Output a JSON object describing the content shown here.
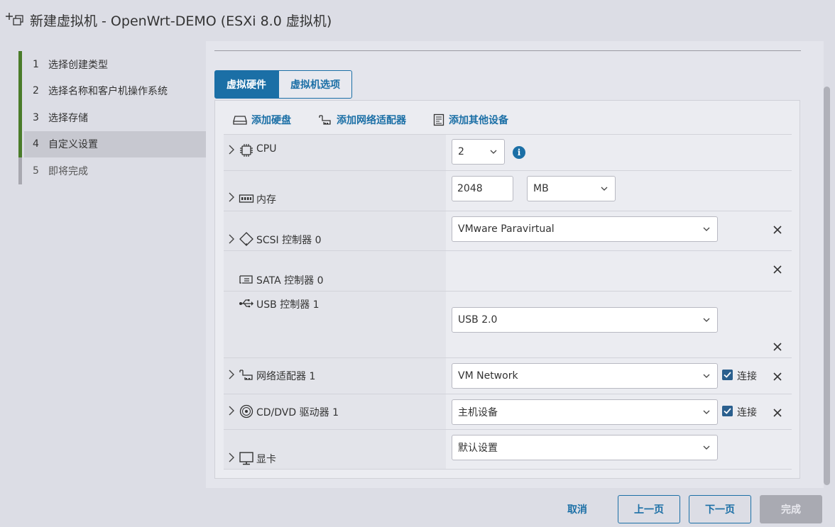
{
  "window": {
    "title": "新建虚拟机 - OpenWrt-DEMO (ESXi 8.0 虚拟机)"
  },
  "wizard": {
    "steps": [
      {
        "num": "1",
        "label": "选择创建类型",
        "state": "done"
      },
      {
        "num": "2",
        "label": "选择名称和客户机操作系统",
        "state": "done"
      },
      {
        "num": "3",
        "label": "选择存储",
        "state": "done"
      },
      {
        "num": "4",
        "label": "自定义设置",
        "state": "active"
      },
      {
        "num": "5",
        "label": "即将完成",
        "state": "pending"
      }
    ]
  },
  "tabs": {
    "hardware": "虚拟硬件",
    "options": "虚拟机选项"
  },
  "toolbar": {
    "add_disk": "添加硬盘",
    "add_nic": "添加网络适配器",
    "add_other": "添加其他设备"
  },
  "devices": {
    "cpu": {
      "name": "CPU",
      "value": "2",
      "info_icon": "i"
    },
    "memory": {
      "name": "内存",
      "value": "2048",
      "unit": "MB"
    },
    "scsi": {
      "name": "SCSI 控制器 0",
      "value": "VMware Paravirtual"
    },
    "sata": {
      "name": "SATA 控制器 0"
    },
    "usb": {
      "name": "USB 控制器 1",
      "value": "USB 2.0"
    },
    "nic": {
      "name": "网络适配器 1",
      "value": "VM Network",
      "connect_label": "连接",
      "connected": true
    },
    "cdrom": {
      "name": "CD/DVD 驱动器 1",
      "value": "主机设备",
      "connect_label": "连接",
      "connected": true
    },
    "video": {
      "name": "显卡",
      "value": "默认设置"
    }
  },
  "footer": {
    "cancel": "取消",
    "back": "上一页",
    "next": "下一页",
    "finish": "完成"
  },
  "colors": {
    "accent": "#1b6fa6",
    "step_done": "#4a7c2a",
    "checkbox": "#2a5f8e"
  }
}
